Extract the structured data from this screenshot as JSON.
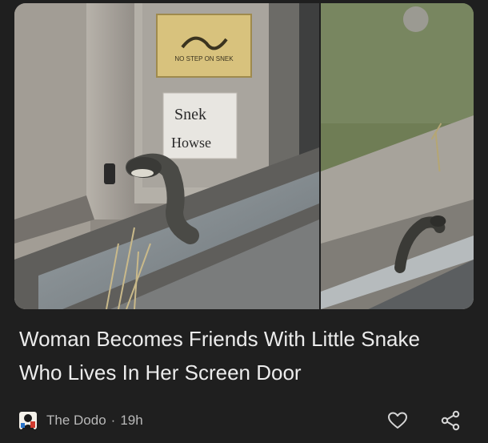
{
  "article": {
    "headline": "Woman Becomes Friends With Little Snake Who Lives In Her Screen Door",
    "source_name": "The Dodo",
    "separator": "·",
    "age": "19h"
  },
  "images": {
    "left": {
      "sticker_text": "NO STEP ON SNEK",
      "sign_line_1": "Snek",
      "sign_line_2": "Howse"
    }
  },
  "icons": {
    "like": "heart-icon",
    "share": "share-icon",
    "source": "the-dodo-logo-icon"
  },
  "colors": {
    "background": "#1f1f1f",
    "headline": "#ececec",
    "meta": "#b9b9b9",
    "icon": "#d6d6d6"
  }
}
